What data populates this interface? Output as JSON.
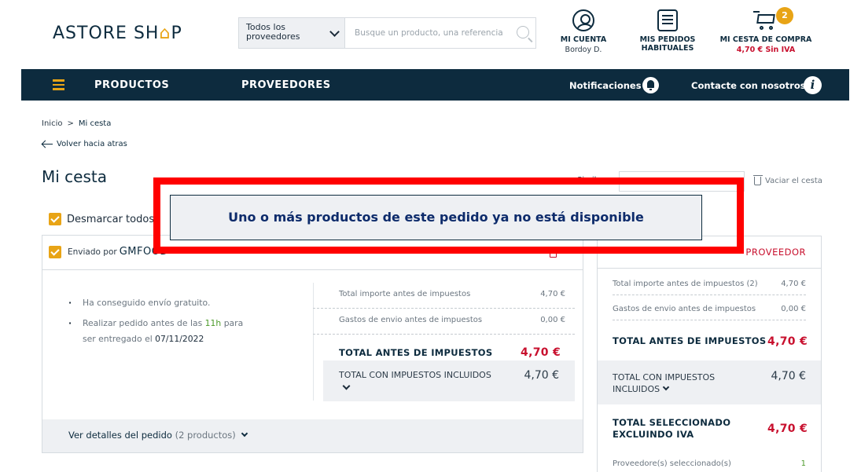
{
  "header": {
    "logo_main": "ASTORE SH",
    "logo_house": "⌂",
    "logo_end": "P",
    "provider_select": "Todos los proveedores",
    "search_placeholder": "Busque un producto, una referencia",
    "account_label": "MI CUENTA",
    "account_user": "Bordoy D.",
    "orders_label_1": "MIS PEDIDOS",
    "orders_label_2": "HABITUALES",
    "cart_label": "MI CESTA DE COMPRA",
    "cart_total": "4,70 € Sin IVA",
    "cart_count": "2"
  },
  "nav": {
    "products": "PRODUCTOS",
    "providers": "PROVEEDORES",
    "notifications": "Notificaciones",
    "contact": "Contacte con nosotros",
    "info_glyph": "i"
  },
  "breadcrumb": {
    "home": "Inicio",
    "sep": ">",
    "current": "Mi cesta",
    "back": "Volver hacia atras"
  },
  "page": {
    "title": "Mi cesta",
    "cut_label": "Simil",
    "clear_cart": "Vaciar el cesta",
    "uncheck_all": "Desmarcar todos"
  },
  "order": {
    "sent_by": "Enviado por",
    "supplier": "GMFOOD",
    "bullet_1": "Ha conseguido envío gratuito.",
    "bullet_2_a": "Realizar pedido antes de las ",
    "bullet_2_time": "11h",
    "bullet_2_b": " para",
    "bullet_2_c": "ser entregado el ",
    "bullet_2_date": "07/11/2022",
    "total_before_tax_label": "Total importe antes de impuestos",
    "total_before_tax_value": "4,70 €",
    "shipping_label": "Gastos de envio antes de impuestos",
    "shipping_value": "0,00 €",
    "total_label": "TOTAL ANTES DE IMPUESTOS",
    "total_value": "4,70 €",
    "total_incl_label": "TOTAL CON IMPUESTOS INCLUIDOS",
    "total_incl_value": "4,70 €",
    "details_label": "Ver detalles del pedido",
    "details_count": "(2 productos)"
  },
  "summary": {
    "provider_heading": "PROVEEDOR",
    "total_before_tax_label": "Total importe antes de impuestos (2)",
    "total_before_tax_value": "4,70 €",
    "shipping_label": "Gastos de envio antes de impuestos",
    "shipping_value": "0,00 €",
    "total_label": "TOTAL ANTES DE IMPUESTOS",
    "total_value": "4,70 €",
    "total_incl_label_1": "TOTAL CON IMPUESTOS",
    "total_incl_label_2": "INCLUIDOS",
    "total_incl_value": "4,70 €",
    "selected_label_1": "TOTAL SELECCIONADO",
    "selected_label_2": "EXCLUINDO IVA",
    "selected_value": "4,70 €",
    "providers_selected_label": "Proveedore(s) seleccionado(s)",
    "providers_selected_value": "1"
  },
  "modal": {
    "message": "Uno o más productos de este pedido ya no está disponible"
  }
}
